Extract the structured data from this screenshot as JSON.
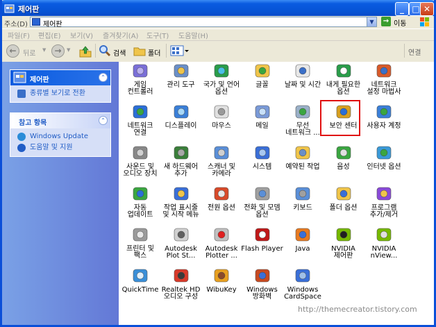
{
  "window": {
    "title": "제어판"
  },
  "address": {
    "label": "주소(D)",
    "value": "제어판",
    "go_label": "이동"
  },
  "menu": [
    "파일(F)",
    "편집(E)",
    "보기(V)",
    "즐겨찾기(A)",
    "도구(T)",
    "도움말(H)"
  ],
  "toolbar": {
    "back": "뒤로",
    "search": "검색",
    "folders": "폴더",
    "links": "연결"
  },
  "panel": {
    "title": "제어판",
    "switch_view": "종류별 보기로 전환",
    "see_also": "참고 항목",
    "links": [
      "Windows Update",
      "도움말 및 지원"
    ]
  },
  "items": [
    {
      "label": "게임\n컨트롤러",
      "icon": "game-controller-icon"
    },
    {
      "label": "관리 도구",
      "icon": "admin-tools-icon"
    },
    {
      "label": "국가 및 언어\n옵션",
      "icon": "globe-icon"
    },
    {
      "label": "글꼴",
      "icon": "fonts-folder-icon"
    },
    {
      "label": "날짜 및 시간",
      "icon": "clock-icon"
    },
    {
      "label": "내게 필요한\n옵션",
      "icon": "accessibility-icon"
    },
    {
      "label": "네트워크\n설정 마법사",
      "icon": "network-wizard-icon"
    },
    {
      "label": "네트워크\n연결",
      "icon": "network-connections-icon"
    },
    {
      "label": "디스플레이",
      "icon": "display-icon"
    },
    {
      "label": "마우스",
      "icon": "mouse-icon"
    },
    {
      "label": "메일",
      "icon": "mail-icon"
    },
    {
      "label": "무선\n네트워크 ...",
      "icon": "wireless-network-icon"
    },
    {
      "label": "보안 센터",
      "icon": "security-center-shield-icon"
    },
    {
      "label": "사용자 계정",
      "icon": "user-accounts-icon"
    },
    {
      "label": "사운드 및\n오디오 장치",
      "icon": "sound-icon"
    },
    {
      "label": "새 하드웨어\n추가",
      "icon": "add-hardware-icon"
    },
    {
      "label": "스캐너 및\n카메라",
      "icon": "scanner-camera-icon"
    },
    {
      "label": "시스템",
      "icon": "system-icon"
    },
    {
      "label": "예약된 작업",
      "icon": "scheduled-tasks-icon"
    },
    {
      "label": "음성",
      "icon": "speech-icon"
    },
    {
      "label": "인터넷 옵션",
      "icon": "internet-options-icon"
    },
    {
      "label": "자동\n업데이트",
      "icon": "automatic-updates-icon"
    },
    {
      "label": "작업 표시줄\n및 시작 메뉴",
      "icon": "taskbar-icon"
    },
    {
      "label": "전원 옵션",
      "icon": "power-options-icon"
    },
    {
      "label": "전화 및 모뎀\n옵션",
      "icon": "phone-modem-icon"
    },
    {
      "label": "키보드",
      "icon": "keyboard-icon"
    },
    {
      "label": "폴더 옵션",
      "icon": "folder-options-icon"
    },
    {
      "label": "프로그램\n추가/제거",
      "icon": "add-remove-programs-icon"
    },
    {
      "label": "프린터 및\n팩스",
      "icon": "printer-fax-icon"
    },
    {
      "label": "Autodesk\nPlot St...",
      "icon": "autodesk-plot-style-icon"
    },
    {
      "label": "Autodesk\nPlotter ...",
      "icon": "autodesk-plotter-icon"
    },
    {
      "label": "Flash Player",
      "icon": "flash-player-icon"
    },
    {
      "label": "Java",
      "icon": "java-icon"
    },
    {
      "label": "NVIDIA\n제어판",
      "icon": "nvidia-control-panel-icon"
    },
    {
      "label": "NVIDIA\nnView...",
      "icon": "nvidia-nview-icon"
    },
    {
      "label": "QuickTime",
      "icon": "quicktime-icon"
    },
    {
      "label": "Realtek HD\n오디오 구성",
      "icon": "realtek-audio-icon"
    },
    {
      "label": "WibuKey",
      "icon": "wibukey-icon"
    },
    {
      "label": "Windows\n방화벽",
      "icon": "windows-firewall-icon"
    },
    {
      "label": "Windows\nCardSpace",
      "icon": "cardspace-icon"
    }
  ],
  "watermark": "http://themecreator.tistory.com",
  "colors": {
    "title_blue": "#0a5be0",
    "highlight_red": "#e01010",
    "link_blue": "#215dc6"
  }
}
